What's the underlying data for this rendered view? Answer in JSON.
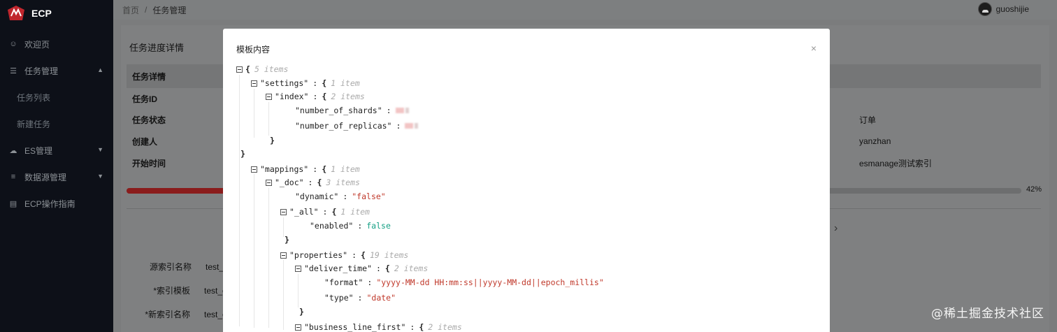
{
  "app": {
    "name": "ECP"
  },
  "sidebar": {
    "items": [
      {
        "label": "欢迎页",
        "icon": "smile-icon"
      },
      {
        "label": "任务管理",
        "icon": "list-icon",
        "expanded": true,
        "children": [
          {
            "label": "任务列表"
          },
          {
            "label": "新建任务"
          }
        ]
      },
      {
        "label": "ES管理",
        "icon": "cloud-icon"
      },
      {
        "label": "数据源管理",
        "icon": "database-icon"
      },
      {
        "label": "ECP操作指南",
        "icon": "book-icon"
      }
    ]
  },
  "header": {
    "breadcrumb": {
      "home": "首页",
      "separator": "/",
      "current": "任务管理"
    },
    "user": {
      "name": "guoshijie"
    }
  },
  "page": {
    "title": "任务进度详情",
    "section_title": "任务详情",
    "rows": [
      {
        "label": "任务ID",
        "value": ""
      },
      {
        "label": "任务状态",
        "value": "订单"
      },
      {
        "label": "创建人",
        "value": "yanzhan"
      },
      {
        "label": "开始时间",
        "value": "esmanage测试索引"
      }
    ],
    "progress": {
      "percent": 42,
      "text": "42%"
    },
    "form": [
      {
        "label": "源索引名称",
        "value": "test_es"
      },
      {
        "label": "*索引模板",
        "value": "test_es"
      },
      {
        "label": "*新索引名称",
        "value": "test_es"
      }
    ]
  },
  "modal": {
    "title": "模板内容",
    "close": "×",
    "json_lines": [
      {
        "depth": 0,
        "toggle": true,
        "brace": "{",
        "meta": "5 items"
      },
      {
        "depth": 1,
        "toggle": true,
        "key": "\"settings\"",
        "brace": "{",
        "meta": "1 item"
      },
      {
        "depth": 2,
        "toggle": true,
        "key": "\"index\"",
        "brace": "{",
        "meta": "2 items"
      },
      {
        "depth": 3,
        "toggle": false,
        "key": "\"number_of_shards\"",
        "redacted": true
      },
      {
        "depth": 3,
        "toggle": false,
        "key": "\"number_of_replicas\"",
        "redacted": true
      },
      {
        "depth": 2,
        "toggle": false,
        "close": "}"
      },
      {
        "depth": 0,
        "toggle": false,
        "close": "}"
      },
      {
        "depth": 1,
        "toggle": true,
        "key": "\"mappings\"",
        "brace": "{",
        "meta": "1 item"
      },
      {
        "depth": 2,
        "toggle": true,
        "key": "\"_doc\"",
        "brace": "{",
        "meta": "3 items"
      },
      {
        "depth": 3,
        "toggle": false,
        "key": "\"dynamic\"",
        "str": "\"false\""
      },
      {
        "depth": 3,
        "toggle": true,
        "key": "\"_all\"",
        "brace": "{",
        "meta": "1 item"
      },
      {
        "depth": 4,
        "toggle": false,
        "key": "\"enabled\"",
        "bool": "false"
      },
      {
        "depth": 3,
        "toggle": false,
        "close": "}"
      },
      {
        "depth": 3,
        "toggle": true,
        "key": "\"properties\"",
        "brace": "{",
        "meta": "19 items"
      },
      {
        "depth": 4,
        "toggle": true,
        "key": "\"deliver_time\"",
        "brace": "{",
        "meta": "2 items"
      },
      {
        "depth": 5,
        "toggle": false,
        "key": "\"format\"",
        "str": "\"yyyy-MM-dd HH:mm:ss||yyyy-MM-dd||epoch_millis\""
      },
      {
        "depth": 5,
        "toggle": false,
        "key": "\"type\"",
        "str": "\"date\""
      },
      {
        "depth": 4,
        "toggle": false,
        "close": "}"
      },
      {
        "depth": 4,
        "toggle": true,
        "key": "\"business_line_first\"",
        "brace": "{",
        "meta": "2 items"
      }
    ]
  },
  "watermark": "@稀土掘金技术社区",
  "colors": {
    "sidebar_bg": "#0d1018",
    "accent": "#c0392b",
    "bool": "#16a085"
  }
}
